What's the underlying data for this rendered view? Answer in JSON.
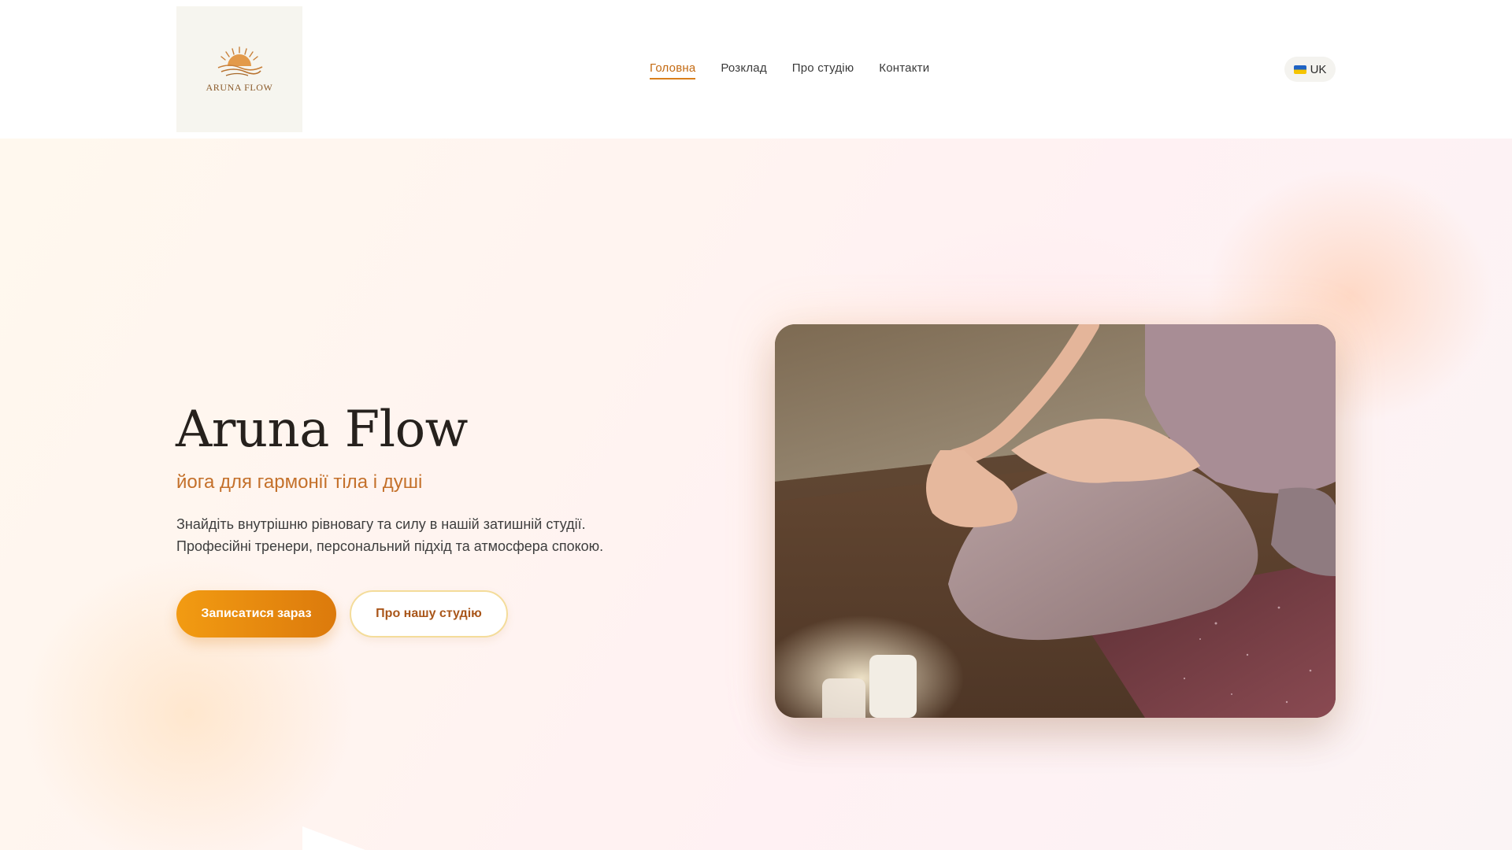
{
  "header": {
    "logo_text": "ARUNA FLOW",
    "nav": [
      {
        "label": "Головна",
        "active": true
      },
      {
        "label": "Розклад",
        "active": false
      },
      {
        "label": "Про студію",
        "active": false
      },
      {
        "label": "Контакти",
        "active": false
      }
    ],
    "language": {
      "label": "UK",
      "icon": "ukraine-flag-icon"
    }
  },
  "hero": {
    "title": "Aruna Flow",
    "subtitle": "йога для гармонії тіла і душі",
    "description_lines": [
      "Знайдіть внутрішню рівновагу та силу в нашій затишній студії.",
      "Професійні тренери, персональний підхід та атмосфера спокою."
    ],
    "primary_button": "Записатися зараз",
    "secondary_button": "Про нашу студію"
  },
  "colors": {
    "accent": "#d97f1c",
    "primary_gradient_start": "#f29b12",
    "primary_gradient_end": "#dc7a0c",
    "subtitle": "#c4702a",
    "title": "#26211d"
  }
}
